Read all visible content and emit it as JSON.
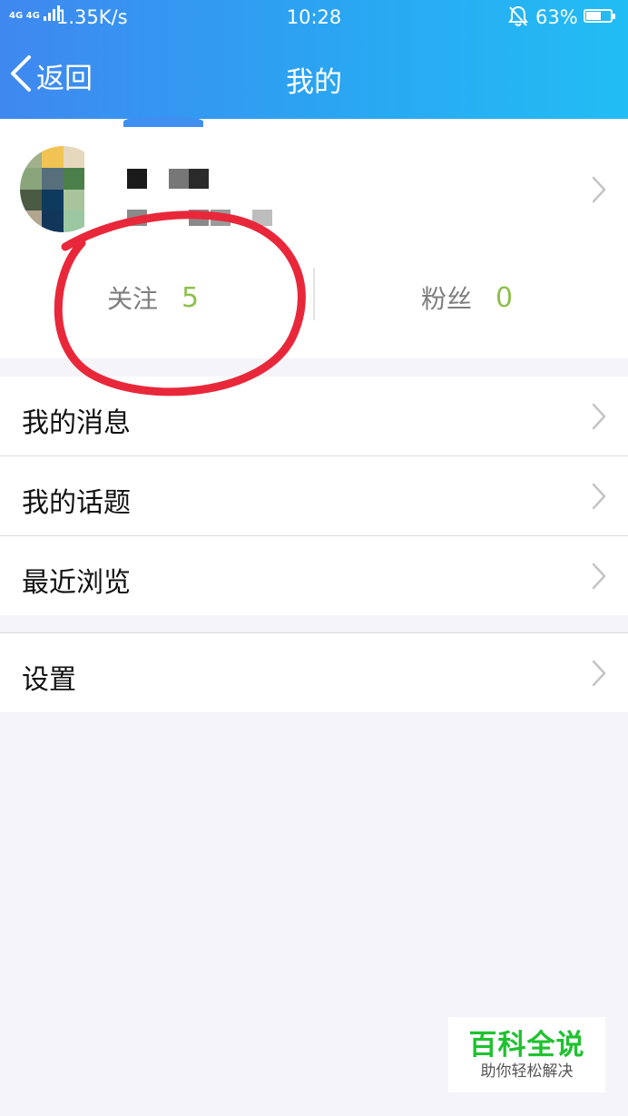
{
  "status_bar": {
    "network": "4G 4G",
    "speed": "1.35K/s",
    "time": "10:28",
    "battery": "63%",
    "battery_level": 0.63
  },
  "nav": {
    "back_label": "返回",
    "title": "我的"
  },
  "profile": {
    "stats": {
      "following_label": "关注",
      "following_count": "5",
      "followers_label": "粉丝",
      "followers_count": "0"
    }
  },
  "menu": {
    "items": [
      {
        "label": "我的消息"
      },
      {
        "label": "我的话题"
      },
      {
        "label": "最近浏览"
      },
      {
        "label": "设置"
      }
    ]
  },
  "watermark": {
    "title": "百科全说",
    "subtitle": "助你轻松解决"
  },
  "colors": {
    "header_start": "#3f88f0",
    "header_end": "#22bdf4",
    "stat_value": "#8fbf4f",
    "annotation": "#e8283a",
    "watermark_green": "#20c130"
  }
}
